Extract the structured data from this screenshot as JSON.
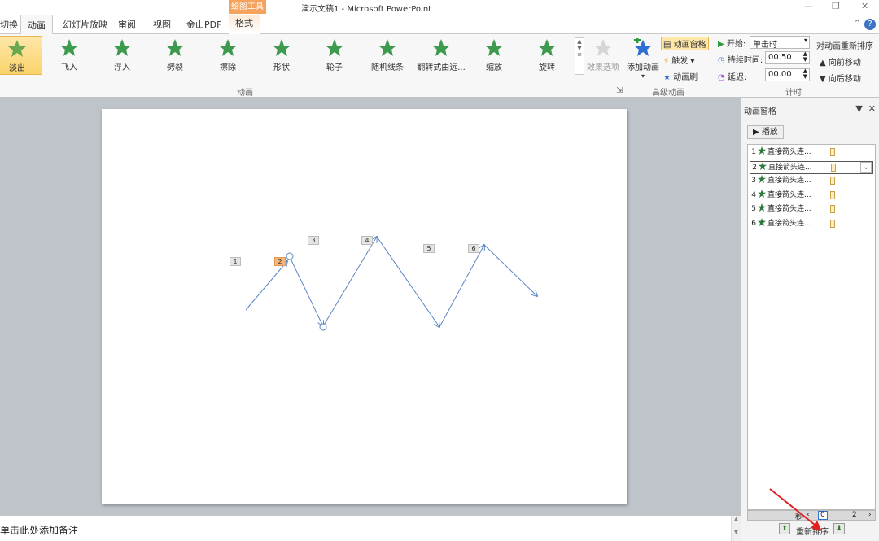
{
  "window": {
    "title": "演示文稿1 - Microsoft PowerPoint",
    "contextual_group": "绘图工具",
    "minimize": "—",
    "restore": "❐",
    "close": "✕"
  },
  "tabs": {
    "transitions": "切换",
    "animations": "动画",
    "slideshow": "幻灯片放映",
    "review": "审阅",
    "view": "视图",
    "wps_pdf": "金山PDF",
    "format": "格式"
  },
  "ribbon": {
    "animations": [
      {
        "label": "淡出",
        "selected": true
      },
      {
        "label": "飞入"
      },
      {
        "label": "浮入"
      },
      {
        "label": "劈裂"
      },
      {
        "label": "擦除"
      },
      {
        "label": "形状"
      },
      {
        "label": "轮子"
      },
      {
        "label": "随机线条"
      },
      {
        "label": "翻转式由远..."
      },
      {
        "label": "缩放"
      },
      {
        "label": "旋转"
      }
    ],
    "effect_options": "效果选项",
    "group_animation": "动画",
    "add_animation": "添加动画",
    "animation_pane": "动画窗格",
    "trigger": "触发",
    "animation_painter": "动画刷",
    "group_advanced": "高级动画",
    "start_label": "开始:",
    "start_value": "单击时",
    "duration_label": "持续时间:",
    "duration_value": "00.50",
    "delay_label": "延迟:",
    "delay_value": "00.00",
    "group_timing": "计时",
    "reorder_title": "对动画重新排序",
    "move_earlier": "向前移动",
    "move_later": "向后移动"
  },
  "slide": {
    "tags": [
      "1",
      "2",
      "3",
      "4",
      "5",
      "6"
    ],
    "selected_tag": "2",
    "arrow_color": "#5b86c5"
  },
  "pane": {
    "title": "动画窗格",
    "play": "播放",
    "items": [
      {
        "num": "1",
        "name": "直接箭头连..."
      },
      {
        "num": "2",
        "name": "直接箭头连...",
        "selected": true
      },
      {
        "num": "3",
        "name": "直接箭头连..."
      },
      {
        "num": "4",
        "name": "直接箭头连..."
      },
      {
        "num": "5",
        "name": "直接箭头连..."
      },
      {
        "num": "6",
        "name": "直接箭头连..."
      }
    ],
    "timeline_unit": "秒",
    "timeline_start": "0",
    "timeline_end": "2",
    "reorder": "重新排序"
  },
  "notes": {
    "placeholder": "单击此处添加备注"
  }
}
